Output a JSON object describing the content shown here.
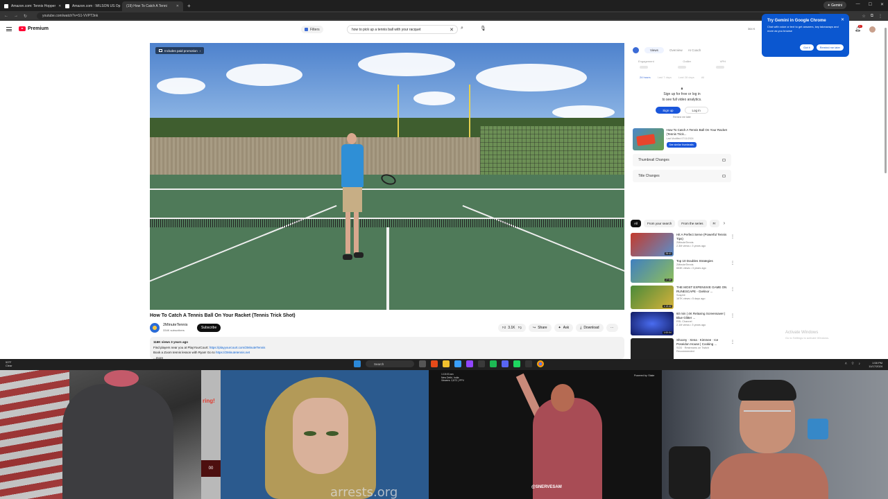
{
  "browser": {
    "tabs": [
      {
        "label": "Amazon.com: Tennis Hopper",
        "active": false
      },
      {
        "label": "Amazon.com : WILSON US Op",
        "active": false
      },
      {
        "label": "(19) How To Catch A Tenni",
        "active": true
      }
    ],
    "gemini_button": "Gemini",
    "url": "youtube.com/watch?v=S1-VVPT3nk"
  },
  "youtube": {
    "logo_text": "Premium",
    "filters_label": "Filters",
    "search_value": "how to pick up a tennis ball with your racquet",
    "notification_count": "9+",
    "header_right_text": "364 K",
    "video": {
      "promo_label": "Includes paid promotion",
      "title": "How To Catch A Tennis Ball On Your Racket (Tennis Trick Shot)",
      "channel": "2MinuteTennis",
      "subscribers": "334K subscribers",
      "subscribe_label": "Subscribe",
      "likes": "3.1K",
      "share_label": "Share",
      "ask_label": "Ask",
      "download_label": "Download",
      "desc_stats": "116K views  3 years ago",
      "desc_line1_text": "Find players near you at PlayYourCourt: ",
      "desc_line1_link": "https://playyourcourt.com/2MinuteTennis",
      "desc_line2_text": "Book a Zoom tennis lesson with Ryan! Go to ",
      "desc_line2_link": "https://2Minutetennis.net",
      "desc_more": "...more"
    }
  },
  "analytics_panel": {
    "tabs": [
      "Views",
      "Overview",
      "AI Coach"
    ],
    "stats": [
      "Engagement",
      "Outlier",
      "VPH"
    ],
    "ranges": [
      "24 hours",
      "Last 7 days",
      "Last 28 days",
      "All"
    ],
    "lock_text_1": "Sign up for free or log in",
    "lock_text_2": "to see full video analytics.",
    "signup_label": "Sign up",
    "login_label": "Log in",
    "remind_label": "Remind me later",
    "video_title": "How To Catch A Tennis Ball On Your Racket (Tennis Trick...",
    "video_updated": "Last Modified 07/11/2024",
    "similar_label": "See similar thumbnails",
    "rows": [
      "Thumbnail Changes",
      "Title Changes"
    ]
  },
  "chips": [
    "All",
    "From your search",
    "From the series",
    "Fr"
  ],
  "related": [
    {
      "title": "Hit A Perfect Serve (Powerful Tennis Tips)",
      "channel": "2MinuteTennis",
      "meta": "2.3M views • 3 years ago",
      "duration": "28:41",
      "thumb": "#c43a2c"
    },
    {
      "title": "Top 10 Doubles Strategies",
      "channel": "2MinuteTennis",
      "meta": "653K views • 3 years ago",
      "duration": "27:59",
      "thumb": "#3f7fc0"
    },
    {
      "title": "THE MOST EXPENSIVE GAME ON RUNESCAPE - Gielinor ...",
      "channel": "Sosphil",
      "meta": "167K views • 5 days ago",
      "duration": "1:13:42",
      "thumb": "#4b8a3a"
    },
    {
      "title": "60 min | 4K Relaxing Screensaver | Blue Glitter ...",
      "channel": "RSL Channel",
      "meta": "2.1M views • 3 years ago",
      "duration": "1:00:04",
      "thumb": "#2240b0"
    },
    {
      "title": "Shoony · Xena · Kimmee · Ice Poseidon House | Cooking ...",
      "channel": "SOD · Restreams on Twitch",
      "meta": "Recommended",
      "duration": "",
      "thumb": "#222222"
    }
  ],
  "watermark": {
    "title": "Activate Windows",
    "sub": "Go to Settings to activate Windows."
  },
  "gemini_popup": {
    "title": "Try Gemini in Google Chrome",
    "body": "Chat with voice or text to get answers, key takeaways and more as you browse",
    "got_it": "Got it",
    "remind": "Remind me later"
  },
  "taskbar": {
    "weather": "53°F",
    "weather_sub": "Clear",
    "search_label": "Search",
    "time": "1:58 PM",
    "date": "11/17/2024"
  },
  "streams": {
    "cam1_badge": "00",
    "cam1_side_text": "ring!",
    "cam2_watermark": "arrests.org",
    "cam3_info": "1:15:03 am\nNew Delhi, India\nViewers: 2,872 | PPV",
    "cam3_tag": "Powered by: Stake",
    "cam3_handle": "@SNERVESAM"
  },
  "colors": {
    "youtube_red": "#ff0033",
    "chrome_dark": "#1f1f1f",
    "gemini_blue": "#0b57d0",
    "link_blue": "#065fd4"
  }
}
